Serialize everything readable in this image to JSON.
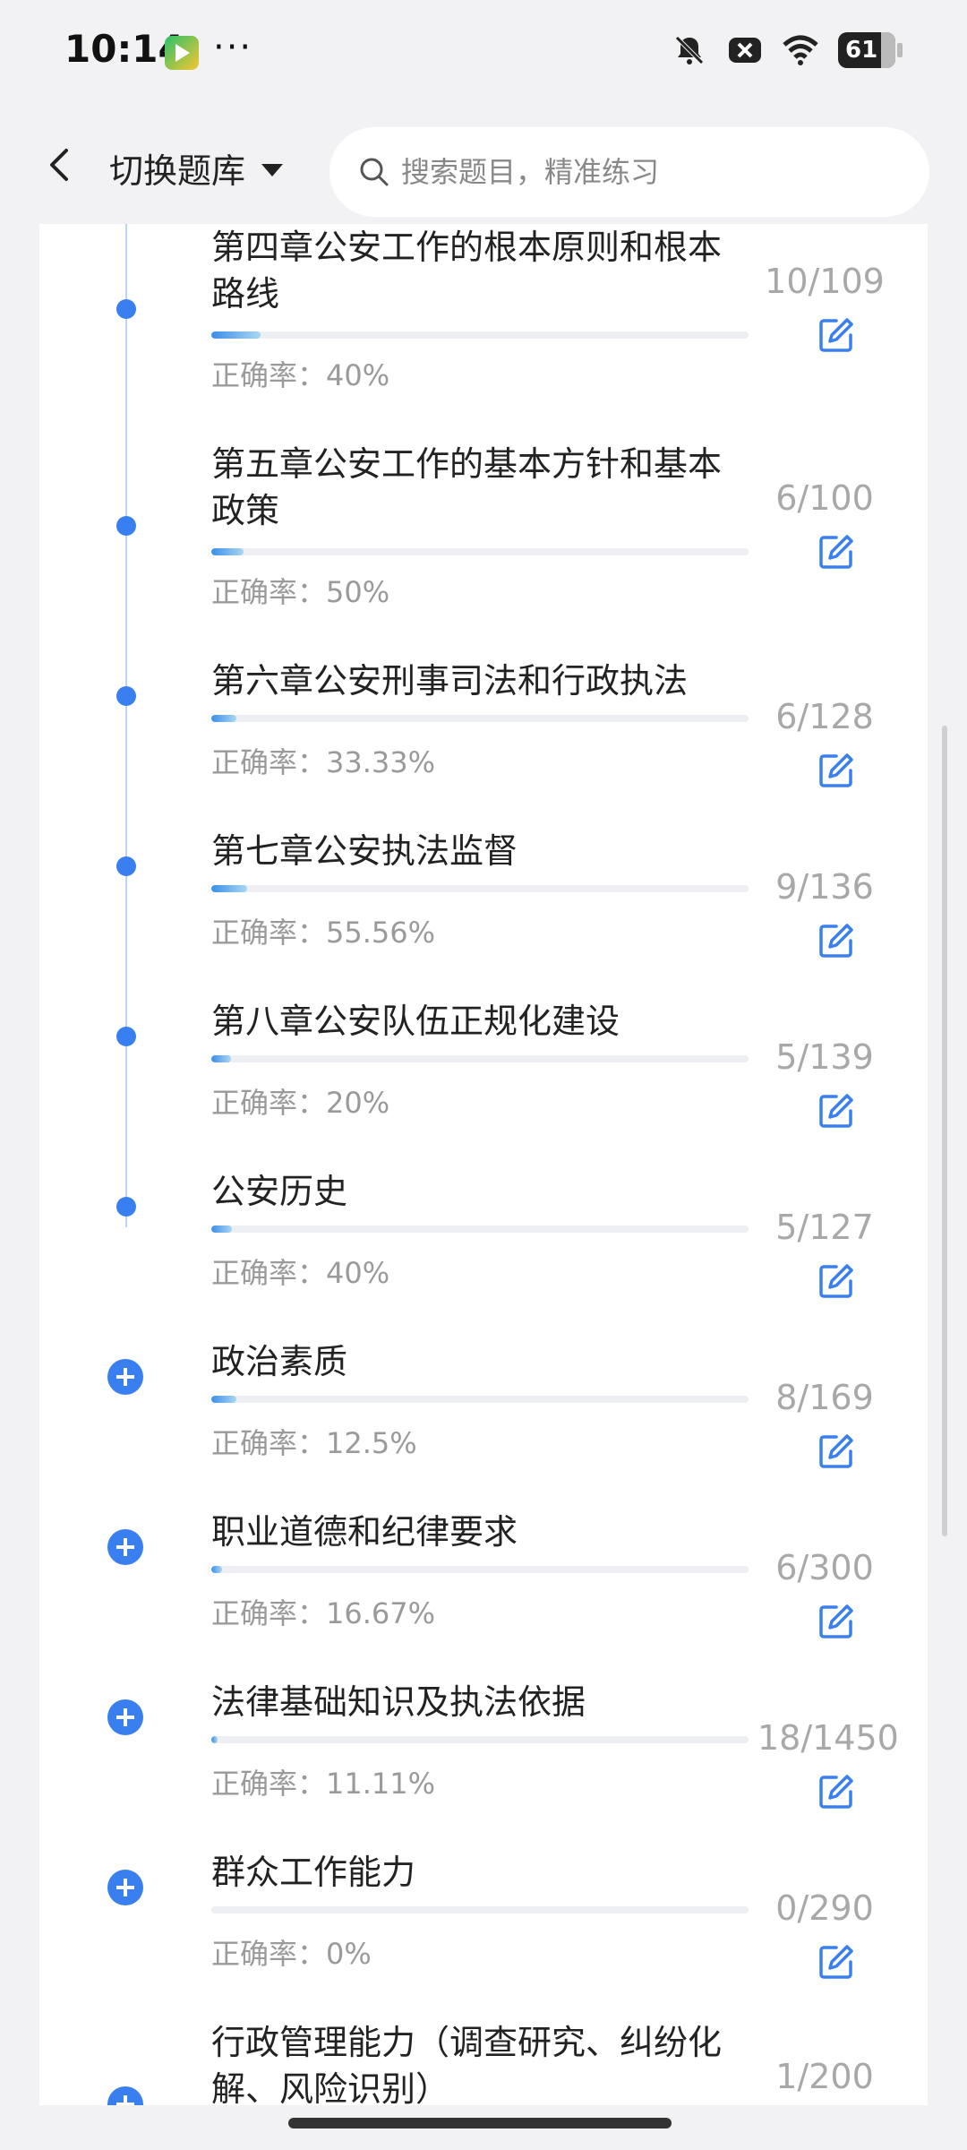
{
  "status_bar": {
    "time": "10:14",
    "dots": "···",
    "battery": "61"
  },
  "header": {
    "bank_switch_label": "切换题库",
    "search_placeholder": "搜索题目，精准练习"
  },
  "chapters": [
    {
      "title": "第四章公安工作的根本原则和根本路线",
      "count": "10/109",
      "rate": "正确率：40%",
      "progress": 0.092,
      "marker": "dot"
    },
    {
      "title": "第五章公安工作的基本方针和基本政策",
      "count": "6/100",
      "rate": "正确率：50%",
      "progress": 0.06,
      "marker": "dot"
    },
    {
      "title": "第六章公安刑事司法和行政执法",
      "count": "6/128",
      "rate": "正确率：33.33%",
      "progress": 0.047,
      "marker": "dot"
    },
    {
      "title": "第七章公安执法监督",
      "count": "9/136",
      "rate": "正确率：55.56%",
      "progress": 0.066,
      "marker": "dot"
    },
    {
      "title": "第八章公安队伍正规化建设",
      "count": "5/139",
      "rate": "正确率：20%",
      "progress": 0.036,
      "marker": "dot"
    },
    {
      "title": "公安历史",
      "count": "5/127",
      "rate": "正确率：40%",
      "progress": 0.039,
      "marker": "dot"
    },
    {
      "title": "政治素质",
      "count": "8/169",
      "rate": "正确率：12.5%",
      "progress": 0.047,
      "marker": "plus"
    },
    {
      "title": "职业道德和纪律要求",
      "count": "6/300",
      "rate": "正确率：16.67%",
      "progress": 0.02,
      "marker": "plus"
    },
    {
      "title": "法律基础知识及执法依据",
      "count": "18/1450",
      "rate": "正确率：11.11%",
      "progress": 0.012,
      "marker": "plus"
    },
    {
      "title": "群众工作能力",
      "count": "0/290",
      "rate": "正确率：0%",
      "progress": 0.0,
      "marker": "plus"
    },
    {
      "title": "行政管理能力（调查研究、纠纷化解、风险识别）",
      "count": "1/200",
      "rate": "",
      "progress": 0.005,
      "marker": "plus"
    }
  ]
}
